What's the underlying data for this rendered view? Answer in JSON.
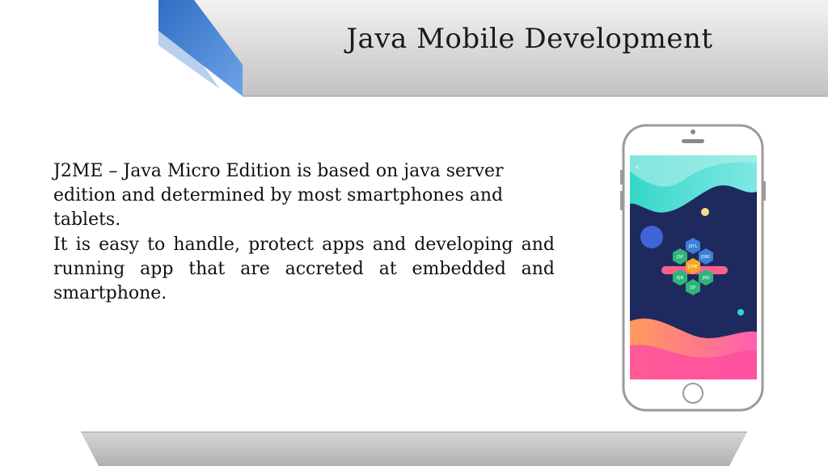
{
  "slide": {
    "title": "Java Mobile Development",
    "paragraphs": [
      "J2ME – Java Micro Edition is based on java server edition and determined by most smartphones and tablets.",
      "It is easy to handle, protect apps and developing and running app that are accreted at embedded and smartphone."
    ]
  },
  "illustration": {
    "hex_labels": [
      "JSTL",
      "JSP",
      "JDBC",
      "J2ME",
      "EJB",
      "JMS",
      "JSF"
    ]
  },
  "colors": {
    "header_gray": "#c9c9c9",
    "accent_blue": "#3c7fd0",
    "phone_bg": "#1e2a5e"
  }
}
